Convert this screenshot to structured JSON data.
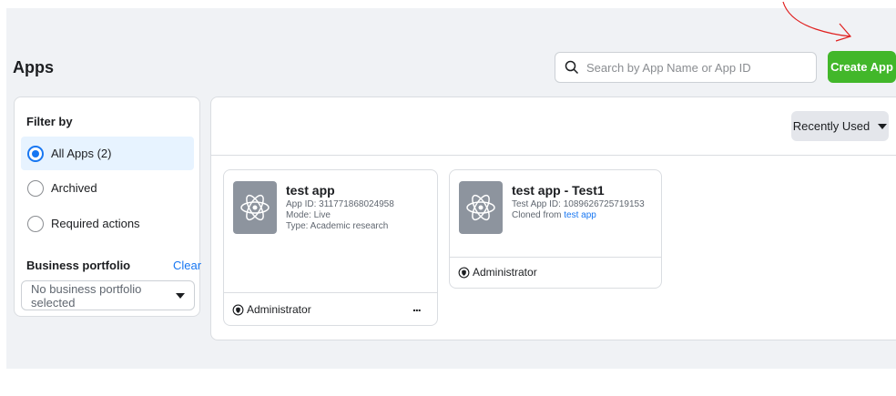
{
  "header": {
    "title": "Apps",
    "search_placeholder": "Search by App Name or App ID",
    "create_button": "Create App"
  },
  "filter": {
    "title": "Filter by",
    "options": [
      {
        "label": "All Apps (2)",
        "selected": true
      },
      {
        "label": "Archived",
        "selected": false
      },
      {
        "label": "Required actions",
        "selected": false
      }
    ],
    "business_portfolio": {
      "title": "Business portfolio",
      "clear_label": "Clear",
      "select_value": "No business portfolio selected"
    }
  },
  "sort": {
    "label": "Recently Used"
  },
  "apps": [
    {
      "name": "test app",
      "lines": [
        "App ID: 311771868024958",
        "Mode: Live",
        "Type: Academic research"
      ],
      "role": "Administrator",
      "more": "..."
    },
    {
      "name": "test app - Test1",
      "id_line": "Test App ID: 1089626725719153",
      "cloned_prefix": "Cloned from ",
      "cloned_link": "test app",
      "role": "Administrator"
    }
  ],
  "colors": {
    "accent_blue": "#1877f2",
    "create_green": "#42b72a",
    "annotation_red": "#e0201f",
    "background_gray": "#f0f2f5"
  }
}
